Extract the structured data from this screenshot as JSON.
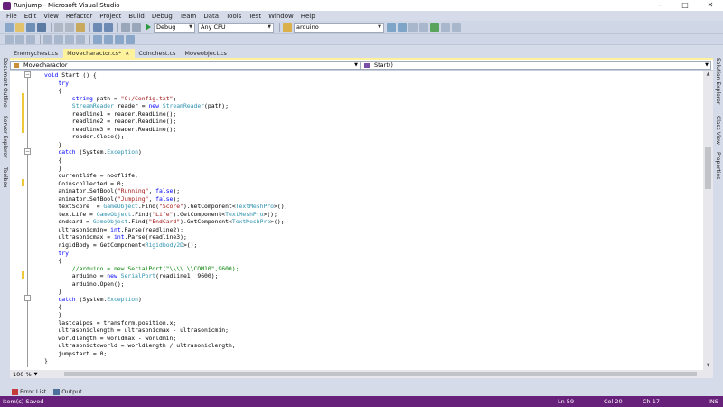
{
  "window": {
    "title": "Runjump - Microsoft Visual Studio"
  },
  "menu": [
    "File",
    "Edit",
    "View",
    "Refactor",
    "Project",
    "Build",
    "Debug",
    "Team",
    "Data",
    "Tools",
    "Test",
    "Window",
    "Help"
  ],
  "toolbar": {
    "config": "Debug",
    "platform": "Any CPU",
    "project": "arduino"
  },
  "left_rail": [
    "Document Outline",
    "Server Explorer",
    "Toolbox"
  ],
  "right_rail": [
    "Solution Explorer",
    "Class View",
    "Properties"
  ],
  "tabs": [
    {
      "label": "Enemychest.cs",
      "active": false
    },
    {
      "label": "Movecharactor.cs*",
      "active": true
    },
    {
      "label": "Coinchest.cs",
      "active": false
    },
    {
      "label": "Moveobject.cs",
      "active": false
    }
  ],
  "nav": {
    "class_combo": "Movecharactor",
    "member_combo": "Start()"
  },
  "code_lines": [
    "void Start () {",
    "    try",
    "    {",
    "        string path = \"C:/Config.txt\";",
    "        StreamReader reader = new StreamReader(path);",
    "        readline1 = reader.ReadLine();",
    "        readline2 = reader.ReadLine();",
    "        readline3 = reader.ReadLine();",
    "        reader.Close();",
    "    }",
    "    catch (System.Exception)",
    "    {",
    "    }",
    "    currentlife = nooflife;",
    "    Coinscollected = 0;",
    "    animator.SetBool(\"Running\", false);",
    "    animator.SetBool(\"Jumping\", false);",
    "    textScore  = GameObject.Find(\"Score\").GetComponent<TextMeshPro>();",
    "    textLife = GameObject.Find(\"Life\").GetComponent<TextMeshPro>();",
    "    endcard = GameObject.Find(\"EndCard\").GetComponent<TextMeshPro>();",
    "    ultrasonicmin= int.Parse(readline2);",
    "    ultrasonicmax = int.Parse(readline3);",
    "    rigidBody = GetComponent<Rigidbody2D>();",
    "    try",
    "    {",
    "        //arduino = new SerialPort(\"\\\\\\\\.\\\\COM10\",9600);",
    "        arduino = new SerialPort(readline1, 9600);",
    "        arduino.Open();",
    "    }",
    "    catch (System.Exception)",
    "    {",
    "    }",
    "    lastcalpos = transform.position.x;",
    "    ultrasoniclength = ultrasonicmax - ultrasonicmin;",
    "    worldlength = worldmax - worldmin;",
    "    ultrasonictoworld = worldlength / ultrasoniclength;",
    "    jumpstart = 0;",
    "}"
  ],
  "zoom": "100 %",
  "bottom_tabs": [
    "Error List",
    "Output"
  ],
  "status": {
    "message": "Item(s) Saved",
    "line": "Ln 59",
    "col": "Col 20",
    "ch": "Ch 17",
    "mode": "INS"
  },
  "colors": {
    "accent": "#68217a",
    "active_tab": "#fff29d",
    "keyword": "#0000ff",
    "string": "#a31515",
    "type": "#2b91af",
    "comment": "#008000"
  }
}
